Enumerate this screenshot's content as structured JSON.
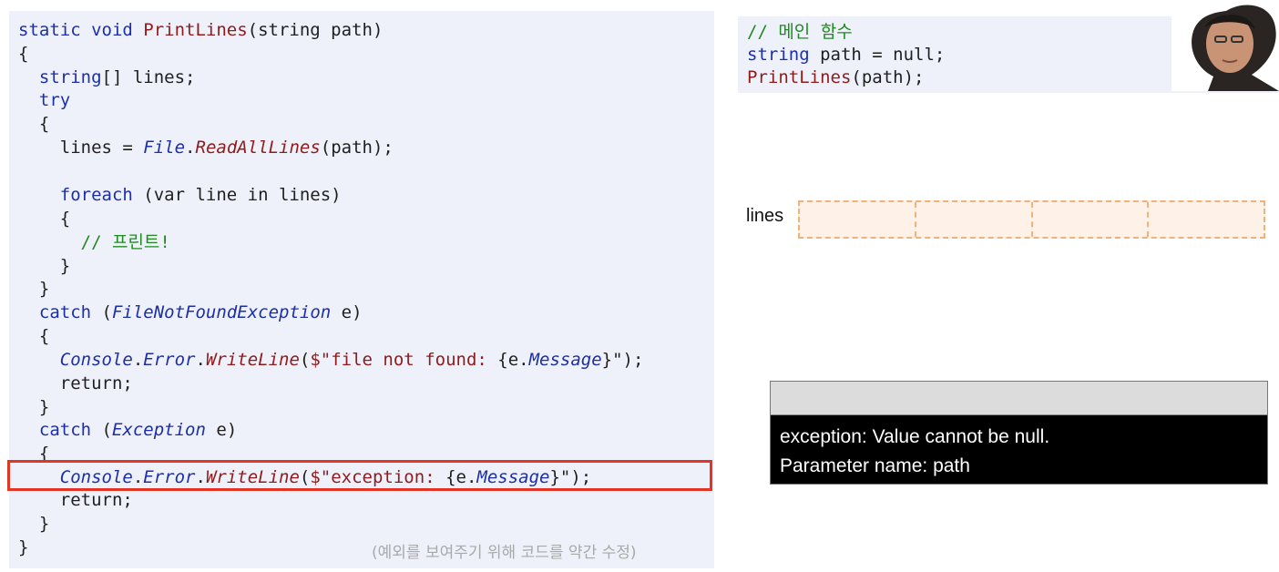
{
  "code": {
    "line1_kw": "static void ",
    "line1_fn": "PrintLines",
    "line1_rest": "(string path)",
    "open1": "{",
    "decl_kw": "string",
    "decl_rest": "[] lines;",
    "try_kw": "try",
    "open2": "{",
    "assign_pre": "lines = ",
    "file_type": "File",
    "dot1": ".",
    "read_fn": "ReadAllLines",
    "assign_post": "(path);",
    "foreach_kw": "foreach",
    "foreach_rest": " (var line in lines)",
    "open3": "{",
    "print_comment": "// 프린트!",
    "close3": "}",
    "close2": "}",
    "catch1_kw": "catch",
    "catch1_open": " (",
    "catch1_type": "FileNotFoundException",
    "catch1_rest": " e)",
    "open4": "{",
    "console1_type": "Console",
    "console1_err": "Error",
    "console1_fn": "WriteLine",
    "console1_str": "$\"file not found: ",
    "console1_brace_open": "{e.",
    "console1_msg": "Message",
    "console1_end": "}\");",
    "return1": "return;",
    "close4": "}",
    "catch2_kw": "catch",
    "catch2_open": " (",
    "catch2_type": "Exception",
    "catch2_rest": " e)",
    "open5": "{",
    "console2_type": "Console",
    "console2_err": "Error",
    "console2_fn": "WriteLine",
    "console2_str": "$\"exception: ",
    "console2_brace_open": "{e.",
    "console2_msg": "Message",
    "console2_end": "}\");",
    "return2": "return;",
    "close5": "}",
    "close1": "}",
    "note": "(예외를 보여주기 위해 코드를 약간 수정)"
  },
  "main": {
    "comment": "// 메인 함수",
    "line2_kw": "string",
    "line2_rest": " path = null;",
    "line3_fn": "PrintLines",
    "line3_rest": "(path);"
  },
  "diagram": {
    "lines_label": "lines",
    "cell_count": 4
  },
  "console": {
    "line1": "exception: Value cannot be null.",
    "line2": "Parameter name: path"
  }
}
